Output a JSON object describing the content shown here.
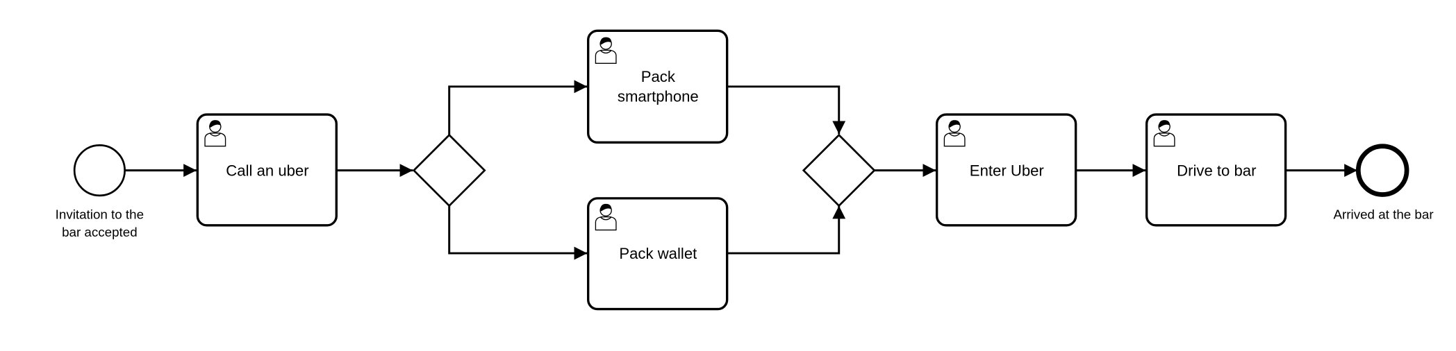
{
  "events": {
    "start": {
      "label_lines": [
        "Invitation to the",
        "bar accepted"
      ]
    },
    "end": {
      "label_lines": [
        "Arrived at the bar"
      ]
    }
  },
  "tasks": [
    {
      "id": "call-uber",
      "lines": [
        "Call an uber"
      ],
      "icon": "user-icon"
    },
    {
      "id": "pack-smartphone",
      "lines": [
        "Pack",
        "smartphone"
      ],
      "icon": "user-icon"
    },
    {
      "id": "pack-wallet",
      "lines": [
        "Pack wallet"
      ],
      "icon": "user-icon"
    },
    {
      "id": "enter-uber",
      "lines": [
        "Enter Uber"
      ],
      "icon": "user-icon"
    },
    {
      "id": "drive-to-bar",
      "lines": [
        "Drive to bar"
      ],
      "icon": "user-icon"
    }
  ],
  "gateways": [
    {
      "id": "split",
      "type": "parallel"
    },
    {
      "id": "join",
      "type": "parallel"
    }
  ]
}
